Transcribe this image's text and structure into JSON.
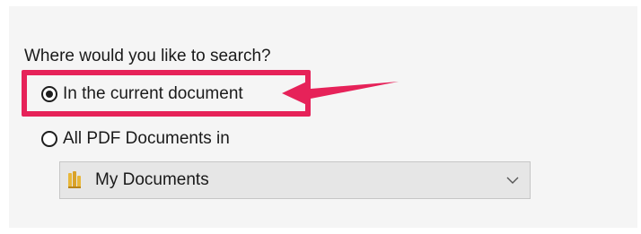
{
  "search_panel": {
    "question": "Where would you like to search?",
    "options": [
      {
        "label": "In the current document",
        "selected": true
      },
      {
        "label": "All PDF Documents in",
        "selected": false
      }
    ],
    "location_dropdown": {
      "value": "My Documents",
      "icon": "folder-icon"
    }
  },
  "annotation": {
    "highlight_color": "#e62259",
    "style": "box-with-arrow"
  }
}
